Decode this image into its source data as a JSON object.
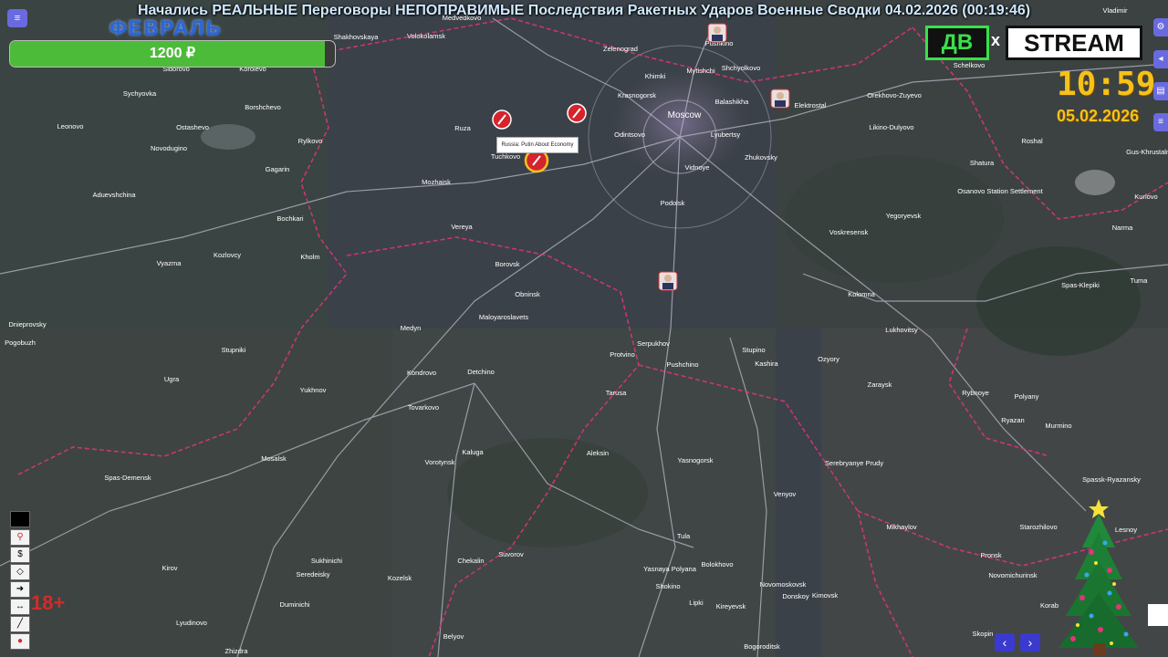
{
  "title": "Начались РЕАЛЬНЫЕ Переговоры НЕПОПРАВИМЫЕ Последствия Ракетных Ударов Военные Сводки 04.02.2026  (00:19:46)",
  "month_label": "ФЕВРАЛЬ",
  "donation": {
    "amount": "1200 ₽",
    "progress_fraction": 0.97
  },
  "logo": {
    "left": "ДВ",
    "x": "x",
    "right": "STREAM"
  },
  "clock": {
    "time": "10:59",
    "date": "05.02.2026"
  },
  "age_rating": "18+",
  "tooltip": "Russia: Putin About Economy",
  "cities": [
    "Medvedkovo",
    "Vladimir",
    "Volokolamsk",
    "Shakhovskaya",
    "Pushkino",
    "Zelenograd",
    "Schelkovo",
    "Khimki",
    "Mytishchi",
    "Shchyolkovo",
    "Krasnogorsk",
    "Balashikha",
    "Elektrostal",
    "Orekhovo-Zuyevo",
    "Moscow",
    "Sidorovo",
    "Korolevo",
    "Sychyovka",
    "Borshchevo",
    "Ruza",
    "Odintsovo",
    "Lyubertsy",
    "Likino-Dulyovo",
    "Roshal",
    "Gus-Khrustalny",
    "Leonovo",
    "Ostashevo",
    "Novodugino",
    "Rylkovo",
    "Tuchkovo",
    "Zhukovsky",
    "Vidnoye",
    "Shatura",
    "Gagarin",
    "Mozhaisk",
    "Aduevshchina",
    "Osanovo Station Settlement",
    "Kurlovo",
    "Bochkari",
    "Vereya",
    "Podolsk",
    "Yegoryevsk",
    "Narma",
    "Voskresensk",
    "Kozlovcy",
    "Kholm",
    "Vyazma",
    "Borovsk",
    "Obninsk",
    "Kolomna",
    "Spas-Klepiki",
    "Tuma",
    "Dnieprovsky",
    "Medyn",
    "Maloyaroslavets",
    "Lukhovitsy",
    "Pogobuzh",
    "Stupniki",
    "Serpukhov",
    "Stupino",
    "Protvino",
    "Kashira",
    "Ozyory",
    "Ugra",
    "Kondrovo",
    "Detchino",
    "Pushchino",
    "Zaraysk",
    "Yukhnov",
    "Tarusa",
    "Rybnoye",
    "Polyany",
    "Tovarkovo",
    "Ryazan",
    "Murmino",
    "Aleksin",
    "Mosalsk",
    "Vorotynsk",
    "Kaluga",
    "Yasnogorsk",
    "Serebryanye Prudy",
    "Spas-Demensk",
    "Spassk-Ryazansky",
    "Venyov",
    "Mikhaylov",
    "Starozhilovo",
    "Tula",
    "Suvorov",
    "Kirov",
    "Sukhinichi",
    "Chekalin",
    "Yasnaya Polyana",
    "Bolokhovo",
    "Pronsk",
    "Seredeisky",
    "Kozelsk",
    "Shokino",
    "Novomichurinsk",
    "Duminichi",
    "Lipki",
    "Novomoskovsk",
    "Donskoy",
    "Kimovsk",
    "Kireyevsk",
    "Lyudinovo",
    "Belyov",
    "Bogoroditsk",
    "Skopin",
    "Zhizdra",
    "Lesnoy",
    "Korab"
  ],
  "tools": [
    "square-tool",
    "pin-tool",
    "coin-tool",
    "polygon-tool",
    "arrow-tool",
    "measure-tool",
    "line-tool",
    "marker-tool"
  ],
  "nav": {
    "prev": "‹",
    "next": "›"
  }
}
